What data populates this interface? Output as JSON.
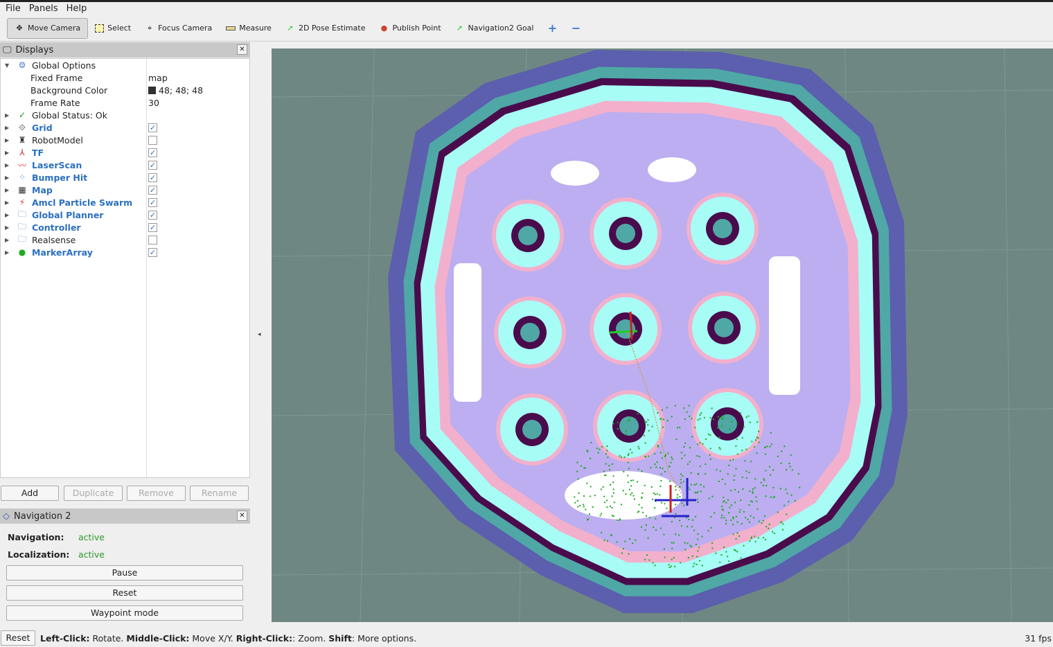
{
  "menu": [
    "File",
    "Panels",
    "Help"
  ],
  "toolbar": [
    {
      "label": "Move Camera",
      "icon": "move-camera-icon",
      "active": true
    },
    {
      "label": "Select",
      "icon": "select-icon"
    },
    {
      "label": "Focus Camera",
      "icon": "focus-camera-icon"
    },
    {
      "label": "Measure",
      "icon": "ruler-icon"
    },
    {
      "label": "2D Pose Estimate",
      "icon": "green-arrow-icon"
    },
    {
      "label": "Publish Point",
      "icon": "map-pin-icon"
    },
    {
      "label": "Navigation2 Goal",
      "icon": "green-arrow-icon"
    }
  ],
  "displays": {
    "title": "Displays",
    "global_options": "Global Options",
    "options": [
      {
        "label": "Fixed Frame",
        "value": "map"
      },
      {
        "label": "Background Color",
        "value": "48; 48; 48",
        "swatch": "#303030"
      },
      {
        "label": "Frame Rate",
        "value": "30"
      }
    ],
    "status": "Global Status: Ok",
    "items": [
      {
        "label": "Grid",
        "checked": true,
        "icon": "grid-icon"
      },
      {
        "label": "RobotModel",
        "checked": false,
        "icon": "robot-icon"
      },
      {
        "label": "TF",
        "checked": true,
        "icon": "tf-axes-icon"
      },
      {
        "label": "LaserScan",
        "checked": true,
        "icon": "laser-scan-icon"
      },
      {
        "label": "Bumper Hit",
        "checked": true,
        "icon": "points-icon"
      },
      {
        "label": "Map",
        "checked": true,
        "icon": "map-icon"
      },
      {
        "label": "Amcl Particle Swarm",
        "checked": true,
        "icon": "particle-icon"
      },
      {
        "label": "Global Planner",
        "checked": true,
        "icon": "folder-icon"
      },
      {
        "label": "Controller",
        "checked": true,
        "icon": "folder-icon"
      },
      {
        "label": "Realsense",
        "checked": false,
        "icon": "folder-icon"
      },
      {
        "label": "MarkerArray",
        "checked": true,
        "icon": "marker-array-icon"
      }
    ],
    "buttons": [
      "Add",
      "Duplicate",
      "Remove",
      "Rename"
    ]
  },
  "nav2": {
    "title": "Navigation 2",
    "navigation_label": "Navigation:",
    "navigation": "active",
    "localization_label": "Localization:",
    "localization": "active",
    "buttons": [
      "Pause",
      "Reset",
      "Waypoint mode"
    ]
  },
  "status": {
    "reset": "Reset",
    "b1": "Left-Click:",
    "t1": " Rotate. ",
    "b2": "Middle-Click:",
    "t2": " Move X/Y. ",
    "b3": "Right-Click:",
    "t3": ": Zoom. ",
    "b4": "Shift",
    "t4": ": More options.",
    "fps": "31 fps"
  },
  "colors": {
    "viewport_bg": "#6f8783",
    "accent": "#2a6fc0",
    "active": "#2a9a2a"
  }
}
